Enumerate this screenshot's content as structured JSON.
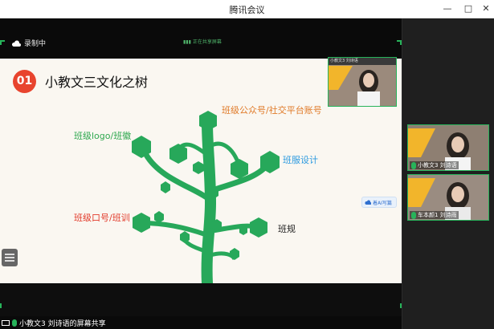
{
  "window": {
    "title": "腾讯会议",
    "minimize": "—",
    "maximize": "□",
    "close": "✕"
  },
  "share": {
    "cloud_status": "录制中",
    "top_hint": "▮▮▮ 正在共享屏幕"
  },
  "slide": {
    "number": "01",
    "title": "小教文三文化之树",
    "labels": {
      "orange": "班级公众号/社交平台账号",
      "green": "班级logo/班徽",
      "blue": "班服设计",
      "red": "班级口号/班训",
      "black": "班规"
    },
    "pill_label": "着AI写篇"
  },
  "bottom": {
    "presenter_label": "小教文3 刘诗语的屏幕共享"
  },
  "participants": [
    {
      "name": "小教文3 刘诗语",
      "mini_top": "小教文3 刘诗语"
    },
    {
      "name": "小教文3 刘诗语"
    },
    {
      "name": "车本颜1 刘诗雨"
    }
  ],
  "colors": {
    "accent_green": "#27b35a",
    "tree_green": "#2fa84f",
    "title_red": "#e8442e"
  },
  "icons": {
    "cloud": "cloud-icon",
    "mic": "mic-icon",
    "screen": "screen-share-icon"
  }
}
